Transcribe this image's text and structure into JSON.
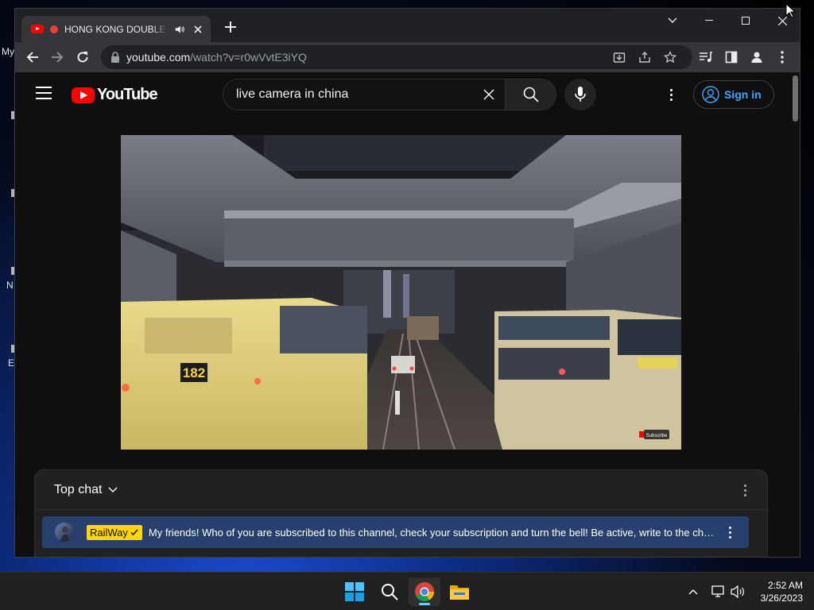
{
  "desktop": {
    "fragments": [
      "My",
      "N",
      "E"
    ]
  },
  "browser": {
    "tab_title": "HONG KONG DOUBLE DECKER",
    "address_url": "youtube.com",
    "address_path": "/watch?v=r0wVvtE3iYQ",
    "window_controls": [
      "minimize",
      "maximize",
      "close"
    ]
  },
  "youtube": {
    "logo_text": "YouTube",
    "search_value": "live camera in china",
    "signin_label": "Sign in",
    "video": {
      "bus_number": "182",
      "watermark": "Subscribe"
    },
    "chat": {
      "title": "Top chat",
      "pinned_author": "RailWay",
      "pinned_message": "My friends! Who of you are subscribed to this channel, check your subscription and turn the bell! Be active, write to the chat! Like this stream!"
    }
  },
  "taskbar": {
    "time": "2:52 AM",
    "date": "3/26/2023"
  },
  "colors": {
    "yt_red": "#ff0000",
    "link_blue": "#3ea6ff",
    "badge_yellow": "#ffd600",
    "pinned_bg": "#28406e"
  },
  "icons": [
    "youtube-favicon-icon",
    "recording-dot-icon",
    "speaker-icon",
    "close-icon",
    "plus-icon",
    "back-icon",
    "forward-icon",
    "reload-icon",
    "lock-icon",
    "install-icon",
    "share-icon",
    "star-icon",
    "media-icon",
    "sidepanel-icon",
    "profile-icon",
    "menu-icon",
    "search-icon",
    "microphone-icon",
    "user-circle-icon",
    "chevron-down-icon",
    "checkmark-icon",
    "windows-logo-icon",
    "chrome-icon",
    "folder-icon",
    "chevron-up-icon",
    "network-icon",
    "volume-icon"
  ]
}
